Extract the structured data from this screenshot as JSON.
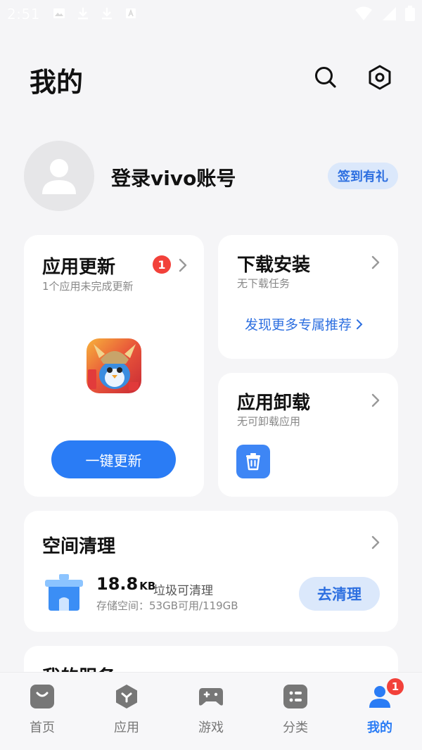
{
  "status_bar": {
    "time": "2:51"
  },
  "header": {
    "title": "我的"
  },
  "account": {
    "login_label": "登录vivo账号",
    "checkin_label": "签到有礼"
  },
  "app_update": {
    "title": "应用更新",
    "subtitle": "1个应用未完成更新",
    "badge": "1",
    "button_label": "一键更新"
  },
  "download": {
    "title": "下载安装",
    "subtitle": "无下载任务",
    "discover_label": "发现更多专属推荐"
  },
  "uninstall": {
    "title": "应用卸载",
    "subtitle": "无可卸载应用"
  },
  "cleanup": {
    "title": "空间清理",
    "size_value": "18.8",
    "size_unit": "KB",
    "size_label": "垃圾可清理",
    "storage_text": "存储空间：53GB可用/119GB",
    "button_label": "去清理"
  },
  "services": {
    "title": "我的服务"
  },
  "tabbar": {
    "items": [
      {
        "label": "首页",
        "icon": "home-bag-icon"
      },
      {
        "label": "应用",
        "icon": "apps-hex-icon"
      },
      {
        "label": "游戏",
        "icon": "gamepad-icon"
      },
      {
        "label": "分类",
        "icon": "category-icon"
      },
      {
        "label": "我的",
        "icon": "person-icon",
        "badge": "1"
      }
    ],
    "active_index": 4
  },
  "colors": {
    "accent": "#2a7cf5",
    "badge": "#f2413a",
    "background": "#f5f5f7"
  }
}
